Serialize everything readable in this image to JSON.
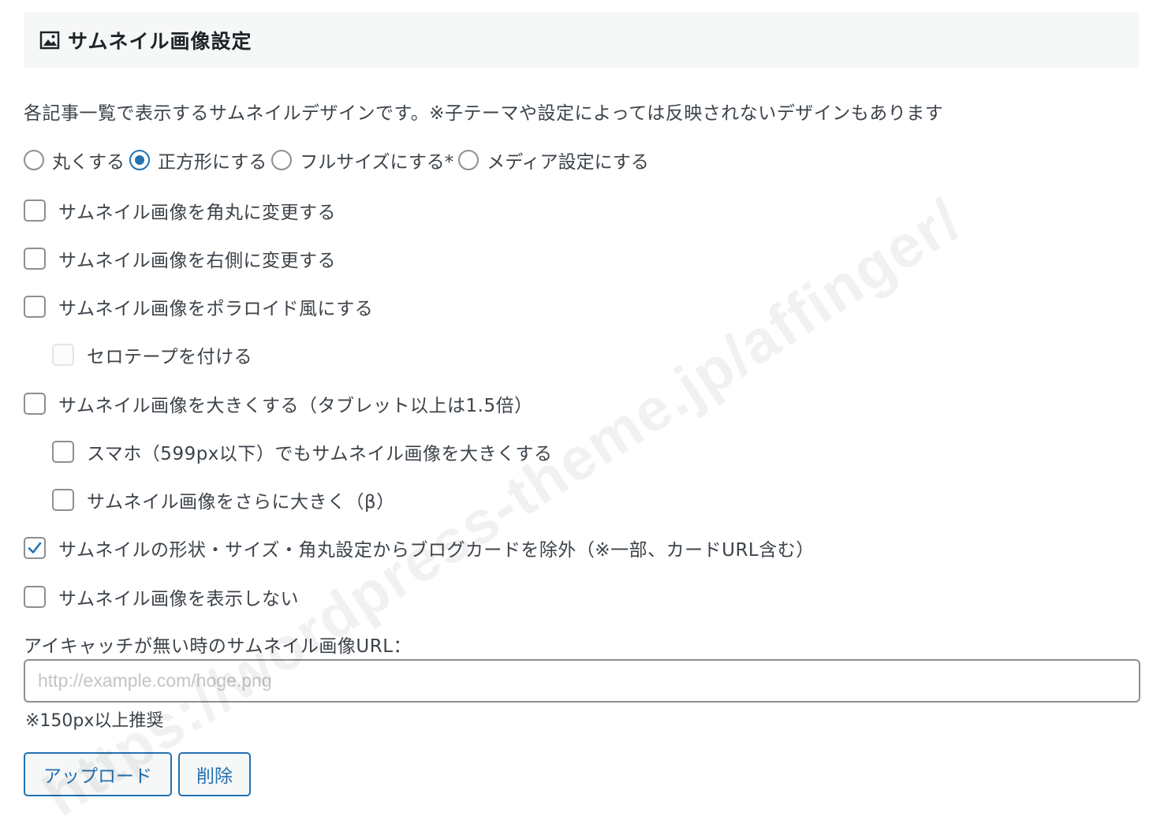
{
  "header": {
    "icon": "image-icon",
    "title": "サムネイル画像設定"
  },
  "description": "各記事一覧で表示するサムネイルデザインです。※子テーマや設定によっては反映されないデザインもあります",
  "radio_options": [
    {
      "label": "丸くする",
      "checked": false
    },
    {
      "label": "正方形にする",
      "checked": true
    },
    {
      "label": "フルサイズにする*",
      "checked": false
    },
    {
      "label": "メディア設定にする",
      "checked": false
    }
  ],
  "checkboxes": [
    {
      "label": "サムネイル画像を角丸に変更する",
      "checked": false,
      "disabled": false
    },
    {
      "label": "サムネイル画像を右側に変更する",
      "checked": false,
      "disabled": false
    },
    {
      "label": "サムネイル画像をポラロイド風にする",
      "checked": false,
      "disabled": false
    },
    {
      "label": "セロテープを付ける",
      "checked": false,
      "disabled": true
    },
    {
      "label": "サムネイル画像を大きくする（タブレット以上は1.5倍）",
      "checked": false,
      "disabled": false
    },
    {
      "label": "スマホ（599px以下）でもサムネイル画像を大きくする",
      "checked": false,
      "disabled": false
    },
    {
      "label": "サムネイル画像をさらに大きく（β）",
      "checked": false,
      "disabled": false
    },
    {
      "label": "サムネイルの形状・サイズ・角丸設定からブログカードを除外（※一部、カードURL含む）",
      "checked": true,
      "disabled": false
    },
    {
      "label": "サムネイル画像を表示しない",
      "checked": false,
      "disabled": false
    }
  ],
  "url_field": {
    "label": "アイキャッチが無い時のサムネイル画像URL：",
    "value": "",
    "placeholder": "http://example.com/hoge.png"
  },
  "note": "※150px以上推奨",
  "buttons": {
    "upload": "アップロード",
    "delete": "削除"
  },
  "watermark": "https://wordpress-theme.jp/affinger/",
  "colors": {
    "accent": "#2271b1",
    "header_bg": "#f6f7f7",
    "text": "#3c434a",
    "border": "#8c8f94"
  }
}
